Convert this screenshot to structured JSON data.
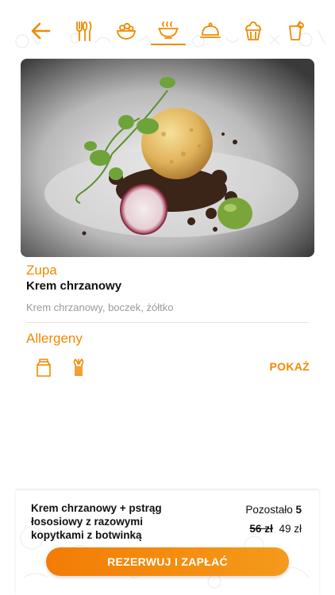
{
  "nav": {
    "items": [
      {
        "icon": "arrow-left-icon"
      },
      {
        "icon": "cutlery-icon"
      },
      {
        "icon": "salad-bowl-icon"
      },
      {
        "icon": "soup-bowl-icon",
        "active": true
      },
      {
        "icon": "cloche-icon"
      },
      {
        "icon": "cupcake-icon"
      },
      {
        "icon": "drink-icon"
      }
    ],
    "accent": "#f08a00"
  },
  "dish": {
    "category": "Zupa",
    "name": "Krem chrzanowy",
    "description": "Krem chrzanowy, boczek, żółtko"
  },
  "allergens": {
    "title": "Allergeny",
    "icons": [
      "milk-carton-icon",
      "celery-icon"
    ],
    "show_label": "POKAŻ"
  },
  "offer": {
    "name": "Krem chrzanowy + pstrąg łososiowy z razowymi kopytkami z botwinką",
    "remaining_label": "Pozostało",
    "remaining_count": "5",
    "old_price": "56 zł",
    "new_price": "49 zł",
    "cta_label": "REZERWUJ I ZAPŁAĆ"
  }
}
